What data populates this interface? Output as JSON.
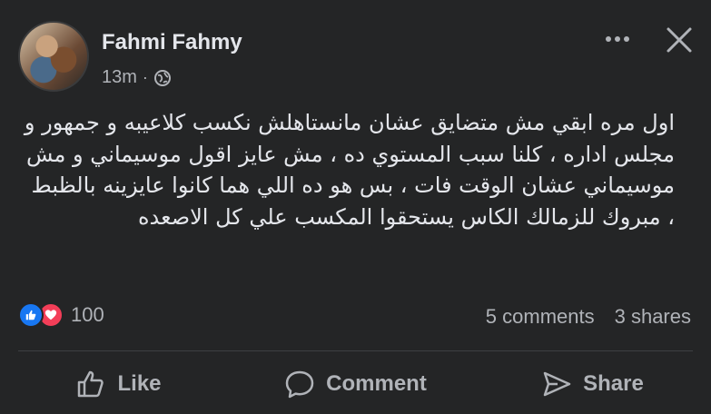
{
  "post": {
    "author": "Fahmi Fahmy",
    "time": "13m",
    "separator": "·",
    "audience_icon": "globe-icon",
    "text": "اول مره ابقي مش متضايق عشان مانستاهلش نكسب كلاعيبه و جمهور و مجلس اداره ، كلنا سبب المستوي ده ، مش عايز اقول موسيماني و مش موسيماني عشان الوقت فات ، بس هو ده اللي هما كانوا عايزينه بالظبط ، مبروك للزمالك الكاس يستحقوا المكسب علي كل الاصعده"
  },
  "reactions": {
    "icons": [
      "like-reaction-icon",
      "love-reaction-icon"
    ],
    "count": "100"
  },
  "stats": {
    "comments": "5 comments",
    "shares": "3 shares"
  },
  "actions": {
    "like": "Like",
    "comment": "Comment",
    "share": "Share"
  },
  "colors": {
    "background": "#242526",
    "text": "#e4e6eb",
    "secondary_text": "#b0b3b8",
    "like_blue": "#1877f2",
    "love_red": "#f33e58"
  }
}
